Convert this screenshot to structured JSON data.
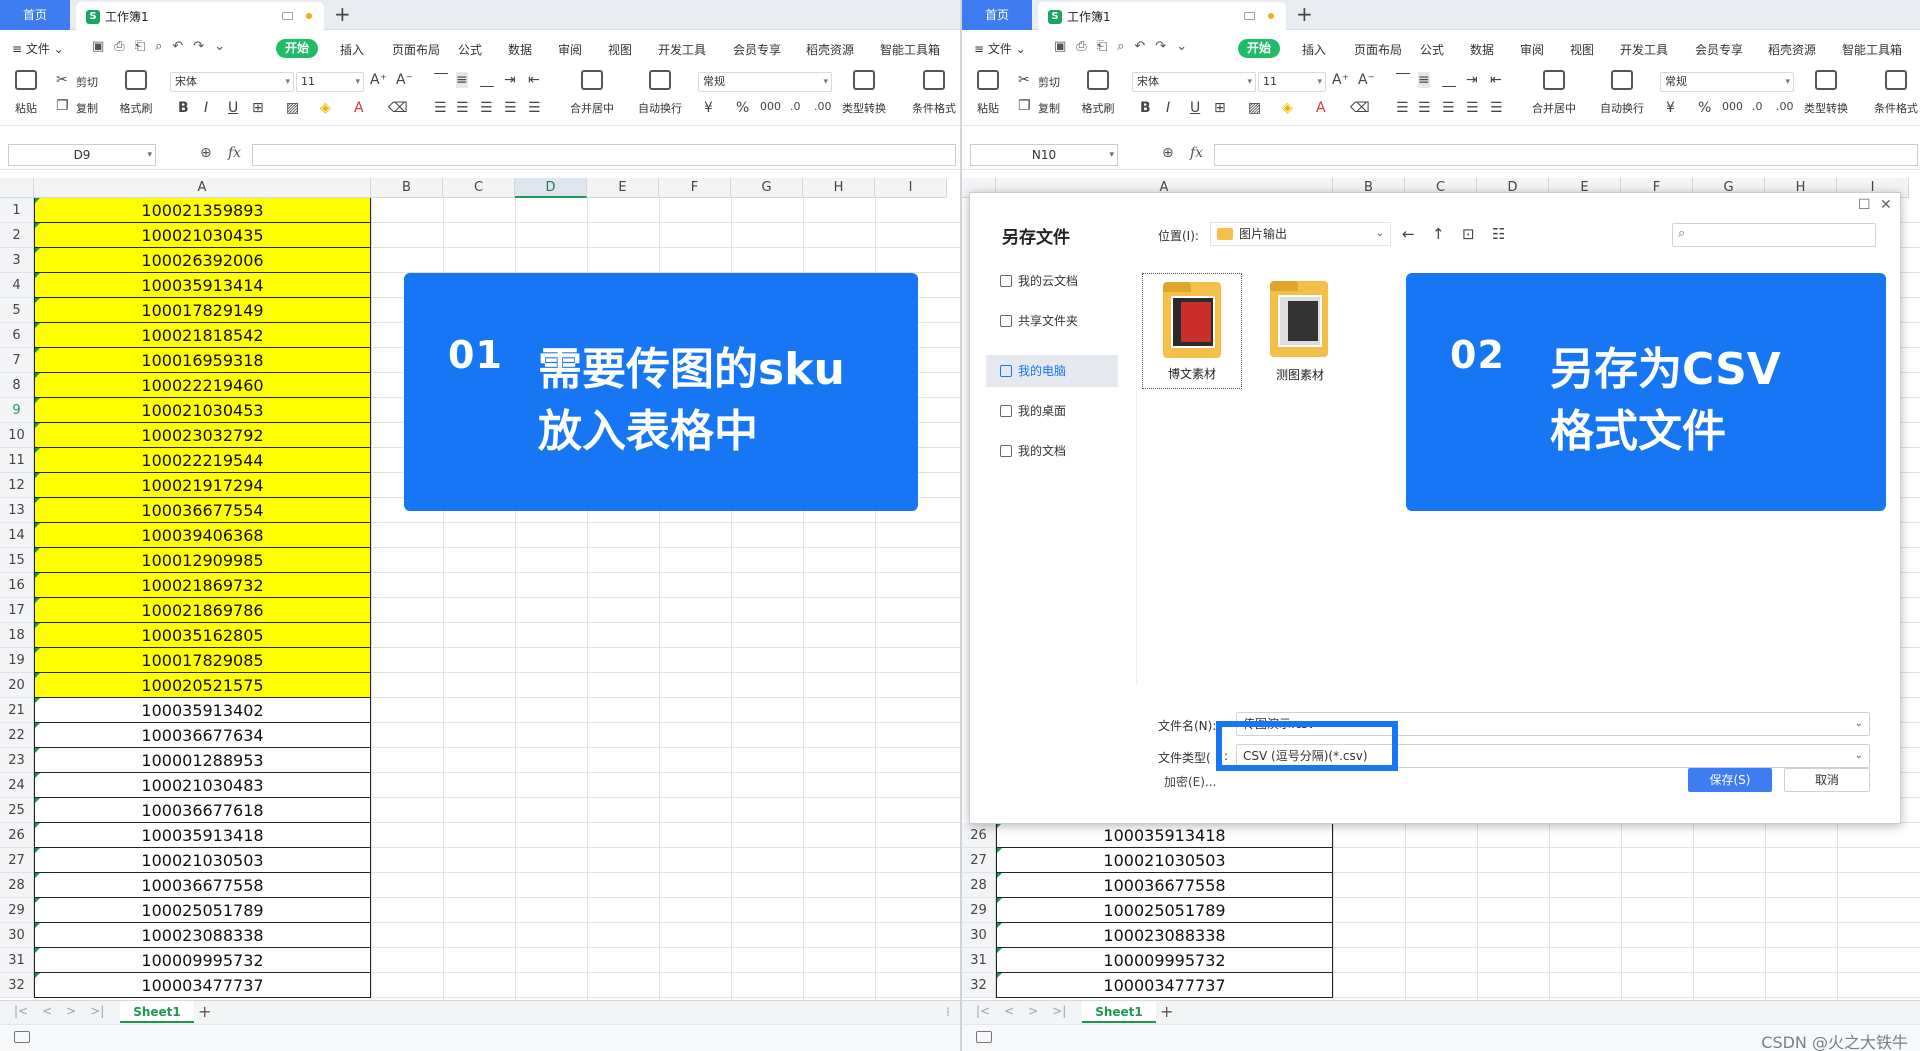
{
  "tabs": {
    "home": "首页",
    "doc": "工作簿1",
    "plus": "+",
    "doc_icon": "S"
  },
  "menu": {
    "file": "≡ 文件 ⌄",
    "start": "开始",
    "items": [
      "插入",
      "页面布局",
      "公式",
      "数据",
      "审阅",
      "视图",
      "开发工具",
      "会员专享",
      "稻壳资源",
      "智能工具箱"
    ]
  },
  "ribbon": {
    "paste": "粘贴",
    "cut": "剪切",
    "copy": "复制",
    "format_painter": "格式刷",
    "font": "宋体",
    "size": "11",
    "merge": "合并居中",
    "wrap": "自动换行",
    "number_format": "常规",
    "convert": "类型转换",
    "cond_format": "条件格式"
  },
  "left": {
    "namebox": "D9",
    "active_col": "D",
    "active_row": 9,
    "columns": [
      "A",
      "B",
      "C",
      "D",
      "E",
      "F",
      "G",
      "H",
      "I"
    ],
    "rows": [
      {
        "n": 1,
        "v": "100021359893",
        "hl": true
      },
      {
        "n": 2,
        "v": "100021030435",
        "hl": true
      },
      {
        "n": 3,
        "v": "100026392006",
        "hl": true
      },
      {
        "n": 4,
        "v": "100035913414",
        "hl": true
      },
      {
        "n": 5,
        "v": "100017829149",
        "hl": true
      },
      {
        "n": 6,
        "v": "100021818542",
        "hl": true
      },
      {
        "n": 7,
        "v": "100016959318",
        "hl": true
      },
      {
        "n": 8,
        "v": "100022219460",
        "hl": true
      },
      {
        "n": 9,
        "v": "100021030453",
        "hl": true
      },
      {
        "n": 10,
        "v": "100023032792",
        "hl": true
      },
      {
        "n": 11,
        "v": "100022219544",
        "hl": true
      },
      {
        "n": 12,
        "v": "100021917294",
        "hl": true
      },
      {
        "n": 13,
        "v": "100036677554",
        "hl": true
      },
      {
        "n": 14,
        "v": "100039406368",
        "hl": true
      },
      {
        "n": 15,
        "v": "100012909985",
        "hl": true
      },
      {
        "n": 16,
        "v": "100021869732",
        "hl": true
      },
      {
        "n": 17,
        "v": "100021869786",
        "hl": true
      },
      {
        "n": 18,
        "v": "100035162805",
        "hl": true
      },
      {
        "n": 19,
        "v": "100017829085",
        "hl": true
      },
      {
        "n": 20,
        "v": "100020521575",
        "hl": true
      },
      {
        "n": 21,
        "v": "100035913402",
        "hl": false
      },
      {
        "n": 22,
        "v": "100036677634",
        "hl": false
      },
      {
        "n": 23,
        "v": "100001288953",
        "hl": false
      },
      {
        "n": 24,
        "v": "100021030483",
        "hl": false
      },
      {
        "n": 25,
        "v": "100036677618",
        "hl": false
      },
      {
        "n": 26,
        "v": "100035913418",
        "hl": false
      },
      {
        "n": 27,
        "v": "100021030503",
        "hl": false
      },
      {
        "n": 28,
        "v": "100036677558",
        "hl": false
      },
      {
        "n": 29,
        "v": "100025051789",
        "hl": false
      },
      {
        "n": 30,
        "v": "100023088338",
        "hl": false
      },
      {
        "n": 31,
        "v": "100009995732",
        "hl": false
      },
      {
        "n": 32,
        "v": "100003477737",
        "hl": false
      }
    ],
    "callout": {
      "num": "01",
      "line1": "需要传图的sku",
      "line2": "放入表格中"
    }
  },
  "right": {
    "namebox": "N10",
    "columns": [
      "A",
      "B",
      "C",
      "D",
      "E",
      "F",
      "G",
      "H",
      "I"
    ],
    "rows": [
      {
        "n": 26,
        "v": "100035913418"
      },
      {
        "n": 27,
        "v": "100021030503"
      },
      {
        "n": 28,
        "v": "100036677558"
      },
      {
        "n": 29,
        "v": "100025051789"
      },
      {
        "n": 30,
        "v": "100023088338"
      },
      {
        "n": 31,
        "v": "100009995732"
      },
      {
        "n": 32,
        "v": "100003477737"
      }
    ],
    "callout": {
      "num": "02",
      "line1": "另存为CSV",
      "line2": "格式文件"
    }
  },
  "dialog": {
    "title": "另存文件",
    "location_label": "位置(I):",
    "location": "图片输出",
    "sidebar": [
      "我的云文档",
      "共享文件夹",
      "我的电脑",
      "我的桌面",
      "我的文档"
    ],
    "active_sidebar": "我的电脑",
    "files": [
      "博文素材",
      "测图素材"
    ],
    "filename_label": "文件名(N):",
    "filename": "传图演示.csv",
    "filetype_label": "文件类型(",
    "filetype_colon": ":",
    "filetype": "CSV (逗号分隔)(*.csv)",
    "encrypt": "加密(E)...",
    "save": "保存(S)",
    "cancel": "取消"
  },
  "sheet": {
    "name": "Sheet1"
  },
  "watermark": "CSDN @火之大铁牛",
  "colors": {
    "accent": "#1676f3",
    "highlight": "#ffff00",
    "green": "#1a9b4b",
    "start": "#1fbd68"
  }
}
